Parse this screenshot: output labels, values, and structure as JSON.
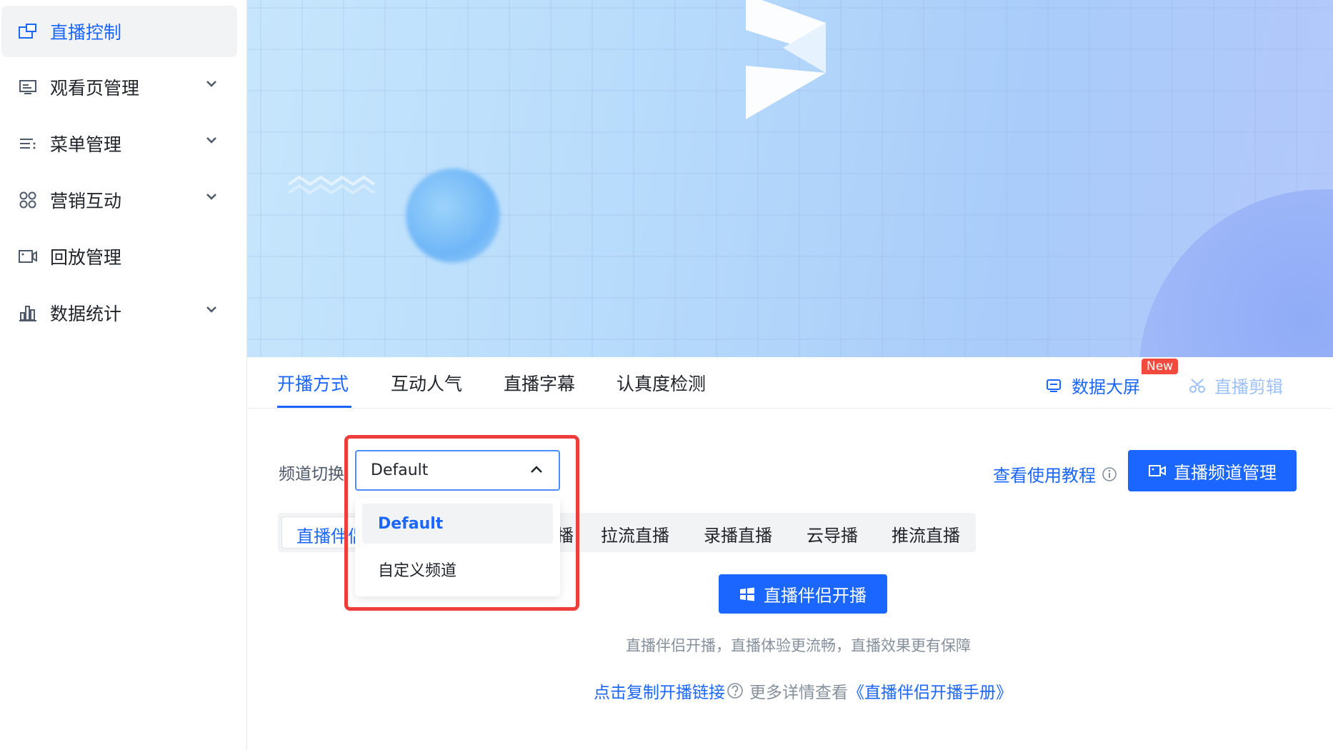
{
  "sidebar": {
    "items": [
      {
        "label": "直播控制",
        "icon": "live-control-icon",
        "active": true,
        "expandable": false
      },
      {
        "label": "观看页管理",
        "icon": "watch-page-icon",
        "active": false,
        "expandable": true
      },
      {
        "label": "菜单管理",
        "icon": "menu-list-icon",
        "active": false,
        "expandable": true
      },
      {
        "label": "营销互动",
        "icon": "marketing-grid-icon",
        "active": false,
        "expandable": true
      },
      {
        "label": "回放管理",
        "icon": "replay-camera-icon",
        "active": false,
        "expandable": false
      },
      {
        "label": "数据统计",
        "icon": "bar-chart-icon",
        "active": false,
        "expandable": true
      }
    ]
  },
  "tabs": {
    "items": [
      "开播方式",
      "互动人气",
      "直播字幕",
      "认真度检测"
    ],
    "active_index": 0,
    "data_screen": "数据大屏",
    "new_badge": "New",
    "live_clip": "直播剪辑"
  },
  "channel": {
    "label": "频道切换",
    "selected": "Default",
    "options": [
      "Default",
      "自定义频道"
    ],
    "dropdown_open": true
  },
  "tutorial_link": "查看使用教程",
  "channel_manage_button": "直播频道管理",
  "modes": {
    "active": "直播伴侣开播",
    "partial_hidden": "播",
    "items": [
      "拉流直播",
      "录播直播",
      "云导播",
      "推流直播"
    ]
  },
  "start_button": "直播伴侣开播",
  "helper_text": "直播伴侣开播，直播体验更流畅，直播效果更有保障",
  "footer": {
    "copy_link": "点击复制开播链接",
    "more_text": "更多详情查看",
    "manual_link": "《直播伴侣开播手册》"
  },
  "colors": {
    "accent": "#1a66ff",
    "highlight": "#ee3d3d",
    "badge": "#f24a3e"
  }
}
